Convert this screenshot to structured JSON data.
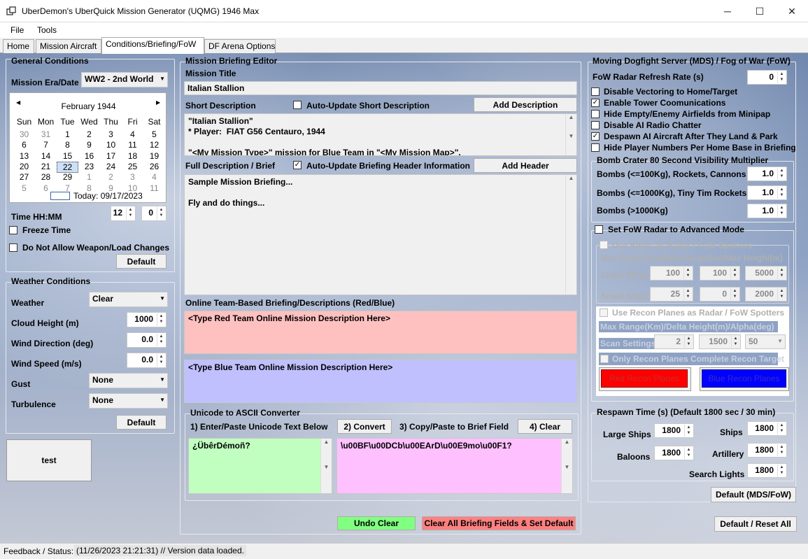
{
  "window": {
    "title": "UberDemon's UberQuick Mission Generator (UQMG) 1946 Max",
    "minimize": "─",
    "maximize": "☐",
    "close": "✕"
  },
  "menu": [
    "File",
    "Tools"
  ],
  "tabs": [
    "Home",
    "Mission Aircraft",
    "Conditions/Briefing/FoW",
    "DF Arena Options"
  ],
  "general": {
    "title": "General Conditions",
    "era_label": "Mission Era/Date",
    "era_value": "WW2 - 2nd World",
    "calendar": {
      "month": "February 1944",
      "prev": "◀",
      "next": "▶",
      "weekdays": [
        "Sun",
        "Mon",
        "Tue",
        "Wed",
        "Thu",
        "Fri",
        "Sat"
      ],
      "weeks": [
        [
          "30",
          "31",
          "1",
          "2",
          "3",
          "4",
          "5"
        ],
        [
          "6",
          "7",
          "8",
          "9",
          "10",
          "11",
          "12"
        ],
        [
          "13",
          "14",
          "15",
          "16",
          "17",
          "18",
          "19"
        ],
        [
          "20",
          "21",
          "22",
          "23",
          "24",
          "25",
          "26"
        ],
        [
          "27",
          "28",
          "29",
          "1",
          "2",
          "3",
          "4"
        ],
        [
          "5",
          "6",
          "7",
          "8",
          "9",
          "10",
          "11"
        ]
      ],
      "today": "Today: 09/17/2023"
    },
    "time_label": "Time HH:MM",
    "hour": "12",
    "minute": "0",
    "freeze_time": "Freeze Time",
    "no_weapon_change": "Do Not Allow Weapon/Load Changes",
    "default": "Default"
  },
  "weather": {
    "title": "Weather Conditions",
    "weather_label": "Weather",
    "weather_value": "Clear",
    "cloud_label": "Cloud Height (m)",
    "cloud_value": "1000",
    "wind_dir_label": "Wind Direction (deg)",
    "wind_dir_value": "0.0",
    "wind_speed_label": "Wind Speed (m/s)",
    "wind_speed_value": "0.0",
    "gust_label": "Gust",
    "gust_value": "None",
    "turb_label": "Turbulence",
    "turb_value": "None",
    "default": "Default"
  },
  "test_button": "test",
  "briefing": {
    "title": "Mission Briefing Editor",
    "mission_title_label": "Mission Title",
    "mission_title": "Italian Stallion",
    "short_label": "Short Description",
    "auto_short": "Auto-Update Short Description",
    "add_desc": "Add Description",
    "short_text": "\"Italian Stallion\"\n* Player:  FIAT G56 Centauro, 1944\n\n\"<My Mission Type>\" mission for Blue Team in \"<My Mission Map>\".",
    "full_label": "Full Description / Brief",
    "auto_header": "Auto-Update Briefing Header Information",
    "add_header": "Add Header",
    "full_text": "Sample Mission Briefing...\n\nFly and do things...",
    "online_label": "Online Team-Based Briefing/Descriptions (Red/Blue)",
    "red_text": "<Type Red Team Online Mission Description Here>",
    "blue_text": "<Type Blue Team Online Mission Description Here>"
  },
  "unicode": {
    "title": "Unicode to ASCII Converter",
    "step1": "1) Enter/Paste Unicode Text Below",
    "convert": "2) Convert",
    "step3": "3) Copy/Paste to Brief Field",
    "clear": "4) Clear",
    "input": "¿ÜbêrDémoñ?",
    "output": "\\u00BF\\u00DCb\\u00EArD\\u00E9mo\\u00F1?"
  },
  "undo_clear": "Undo Clear",
  "clear_all": "Clear All Briefing Fields & Set Default",
  "mds": {
    "title": "Moving Dogfight Server (MDS) / Fog of War (FoW)",
    "radar_rate_label": "FoW Radar Refresh Rate (s)",
    "radar_rate": "0",
    "options": [
      {
        "label": "Disable Vectoring to Home/Target",
        "checked": ""
      },
      {
        "label": "Enable Tower Coomunications",
        "checked": "✓"
      },
      {
        "label": "Hide Empty/Enemy Airfields from Minipap",
        "checked": ""
      },
      {
        "label": "Disable AI Radio Chatter",
        "checked": ""
      },
      {
        "label": "Despawn AI Aircraft After They Land & Park",
        "checked": "✓"
      },
      {
        "label": "Hide Player Numbers Per Home Base in Briefing",
        "checked": ""
      }
    ],
    "crater_title": "Bomb Crater 80 Second Visibility Multiplier",
    "crater1_label": "Bombs (<=100Kg), Rockets, Cannons",
    "crater1": "1.0",
    "crater2_label": "Bombs (<=1000Kg), Tiny Tim Rockets",
    "crater2": "1.0",
    "crater3_label": "Bombs (>1000Kg)",
    "crater3": "1.0",
    "adv_mode": "Set FoW Radar to Advanced Mode",
    "ships_radar": "Use Ships as Radar / FoW Spotters",
    "range_header": "Max Range(Km)/Min Height(m)/Max Height(m)",
    "large_ships": "Large Ships",
    "large": [
      "100",
      "100",
      "5000"
    ],
    "small_ships": "Small Ships",
    "small": [
      "25",
      "0",
      "2000"
    ],
    "recon_radar": "Use Recon Planes as Radar / FoW Spotters",
    "recon_header": "Max Range(Km)/Delta Height(m)/Alpha(deg)",
    "scan_label": "Scan Settings",
    "scan": [
      "2",
      "1500",
      "50"
    ],
    "only_recon": "Only Recon Planes Complete Recon Target",
    "red_recon": "Red Recon Planes",
    "blue_recon": "Blue Recon Planes",
    "respawn_title": "Respawn Time (s) (Default 1800 sec / 30 min)",
    "large_ships_r": "Large Ships",
    "large_ships_v": "1800",
    "ships_r": "Ships",
    "ships_v": "1800",
    "baloons_r": "Baloons",
    "baloons_v": "1800",
    "artillery_r": "Artillery",
    "artillery_v": "1800",
    "search_r": "Search Lights",
    "search_v": "1800",
    "default_mds": "Default (MDS/FoW)",
    "default_reset": "Default / Reset All"
  },
  "status": {
    "label": "Feedback / Status:",
    "text": "(11/26/2023 21:21:31) // Version data loaded."
  },
  "colors": {
    "red": "#ffc0c0",
    "blue": "#c0c0ff",
    "green": "#c0ffc0",
    "pink": "#ffc0ff"
  }
}
